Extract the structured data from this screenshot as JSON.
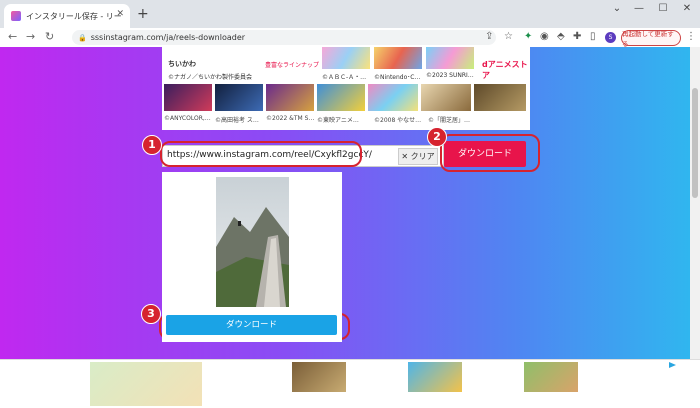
{
  "browser": {
    "tab_title": "インスタリール保存 - リール ダウンロー",
    "tab_close": "✕",
    "new_tab": "+",
    "address": "sssinstagram.com/ja/reels-downloader",
    "restart_label": "再起動して更新する",
    "avatar_letter": "S",
    "nav_icons": {
      "back": "←",
      "forward": "→",
      "reload": "↻"
    },
    "window_controls": {
      "chevron": "⌄",
      "minimize": "—",
      "maximize": "☐",
      "close": "✕"
    }
  },
  "ad_panel": {
    "top_label": "ちいかわ",
    "top_sub": "©ナガノ／ちいかわ製作委員会",
    "lineup": "豊富なラインナップ",
    "top_caption_1": "©ＡＢＣ-Ａ・…",
    "top_caption_2": "©Nintendo･C…",
    "top_caption_3": "©2023 SUNRI…",
    "store_name": "dアニメストア",
    "captions": [
      "©ANYCOLOR,…",
      "©高田裕考 ス…",
      "©2022 &TM S…",
      "©東映アニメ…",
      "©2008 やなせ…",
      "©「闇芝居」…"
    ]
  },
  "downloader": {
    "url_value": "https://www.instagram.com/reel/Cxykfl2gccY/",
    "clear_label": "クリア",
    "clear_icon": "✕",
    "download_label": "ダウンロード",
    "result_download_label": "ダウンロード"
  },
  "callouts": [
    "1",
    "2",
    "3"
  ],
  "colors": {
    "accent_pink": "#e8144b",
    "accent_blue": "#1aa3e6",
    "callout_red": "#d6232f"
  }
}
